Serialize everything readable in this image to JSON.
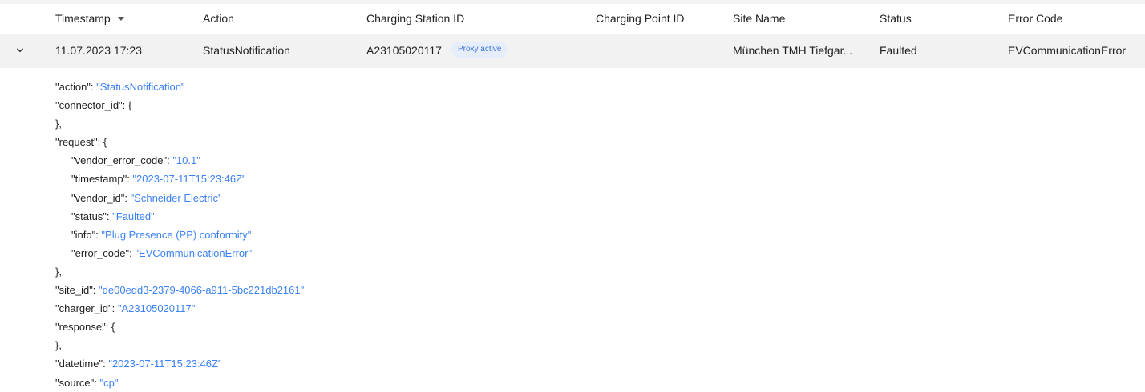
{
  "table": {
    "headers": {
      "timestamp": "Timestamp",
      "action": "Action",
      "charging_station_id": "Charging Station ID",
      "charging_point_id": "Charging Point ID",
      "site_name": "Site Name",
      "status": "Status",
      "error_code": "Error Code"
    },
    "sort_icon": "sort-desc-icon",
    "row": {
      "timestamp": "11.07.2023 17:23",
      "action": "StatusNotification",
      "charging_station_id": "A23105020117",
      "badge": "Proxy active",
      "charging_point_id": "",
      "site_name": "München TMH Tiefgar...",
      "status": "Faulted",
      "error_code": "EVCommunicationError",
      "expand_icon": "chevron-down-icon"
    }
  },
  "details": {
    "l1_key": "\"action\": ",
    "l1_val": "\"StatusNotification\"",
    "l2": "\"connector_id\": {",
    "l3": "},",
    "l4": "\"request\": {",
    "l5_key": "\"vendor_error_code\": ",
    "l5_val": "\"10.1\"",
    "l6_key": "\"timestamp\": ",
    "l6_val": "\"2023-07-11T15:23:46Z\"",
    "l7_key": "\"vendor_id\": ",
    "l7_val": "\"Schneider Electric\"",
    "l8_key": "\"status\": ",
    "l8_val": "\"Faulted\"",
    "l9_key": "\"info\": ",
    "l9_val": "\"Plug Presence (PP) conformity\"",
    "l10_key": "\"error_code\": ",
    "l10_val": "\"EVCommunicationError\"",
    "l11": "},",
    "l12_key": "\"site_id\": ",
    "l12_val": "\"de00edd3-2379-4066-a911-5bc221db2161\"",
    "l13_key": "\"charger_id\": ",
    "l13_val": "\"A23105020117\"",
    "l14": "\"response\": {",
    "l15": "},",
    "l16_key": "\"datetime\": ",
    "l16_val": "\"2023-07-11T15:23:46Z\"",
    "l17_key": "\"source\": ",
    "l17_val": "\"cp\""
  },
  "colors": {
    "row_bg": "#f2f2f3",
    "badge_bg": "#e6eefb",
    "badge_text": "#3d74d8",
    "json_value": "#3b82f6"
  }
}
